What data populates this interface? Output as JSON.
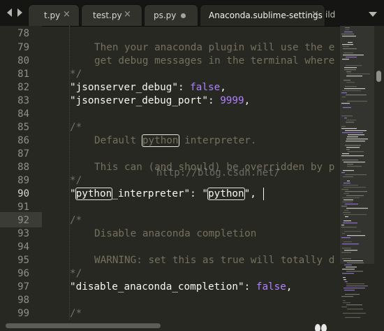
{
  "tabs": [
    {
      "label": "t.py",
      "close": "×",
      "active": false
    },
    {
      "label": "test.py",
      "close": "×",
      "active": false
    },
    {
      "label": "ps.py",
      "dirty": true,
      "active": false
    },
    {
      "label": "Anaconda.sublime-settings",
      "close": "×",
      "active": true
    },
    {
      "label": "ild",
      "partial": true
    }
  ],
  "current_line": 90,
  "line_numbers": [
    "78",
    "79",
    "80",
    "81",
    "82",
    "83",
    "84",
    "85",
    "86",
    "87",
    "88",
    "89",
    "90",
    "91",
    "92",
    "93",
    "94",
    "95",
    "96",
    "97",
    "98",
    "99"
  ],
  "code": {
    "l79": "Then your anaconda plugin will use the e",
    "l80": "get debug messages in the terminal where",
    "l81": "*/",
    "l82_key": "\"jsonserver_debug\"",
    "l82_colon": ": ",
    "l82_val": "false",
    "l82_end": ",",
    "l83_key": "\"jsonserver_debug_port\"",
    "l83_colon": ": ",
    "l83_val": "9999",
    "l83_end": ",",
    "l85": "/*",
    "l86_a": "Default ",
    "l86_hl": "python",
    "l86_b": " interpreter.",
    "l88": "This can (and should) be overridden by p",
    "l89": "*/",
    "l90_q1": "\"",
    "l90_hl1": "python",
    "l90_key_rest": "_interpreter\"",
    "l90_colon": ": \"",
    "l90_hl2": "python",
    "l90_end": "\",",
    "l92": "/*",
    "l93": "Disable anaconda completion",
    "l95": "WARNING: set this as true will totally d",
    "l96": "*/",
    "l97_key": "\"disable_anaconda_completion\"",
    "l97_colon": ": ",
    "l97_val": "false",
    "l97_end": ",",
    "l99": "/*"
  },
  "watermark": "http://blog.csdn.net/",
  "colors": {
    "background": "#272822",
    "comment": "#75715e",
    "constant": "#ae81ff",
    "text": "#f8f8f2"
  }
}
